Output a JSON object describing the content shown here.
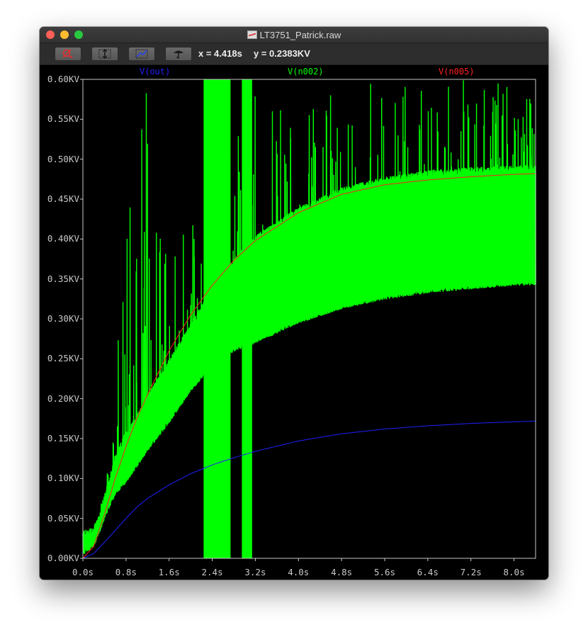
{
  "window": {
    "title": "LT3751_Patrick.raw"
  },
  "toolbar": {
    "buttons": [
      {
        "icon": "zoom-out-icon"
      },
      {
        "icon": "autorange-y-icon"
      },
      {
        "icon": "zoom-full-icon"
      },
      {
        "icon": "pan-icon"
      }
    ],
    "x_readout": "x = 4.418s",
    "y_readout": "y = 0.2383KV"
  },
  "colors": {
    "vout": "#2020ff",
    "vn002": "#00ff00",
    "vn005": "#ff2020",
    "axis": "#c8c8c8",
    "background": "#000000"
  },
  "chart_data": {
    "type": "line",
    "x_unit": "s",
    "y_unit": "KV",
    "xlim": [
      0.0,
      8.4
    ],
    "ylim": [
      0.0,
      0.6
    ],
    "x_ticks": [
      "0.0s",
      "0.8s",
      "1.6s",
      "2.4s",
      "3.2s",
      "4.0s",
      "4.8s",
      "5.6s",
      "6.4s",
      "7.2s",
      "8.0s"
    ],
    "y_ticks": [
      "0.00KV",
      "0.05KV",
      "0.10KV",
      "0.15KV",
      "0.20KV",
      "0.25KV",
      "0.30KV",
      "0.35KV",
      "0.40KV",
      "0.45KV",
      "0.50KV",
      "0.55KV",
      "0.60KV"
    ],
    "series": [
      {
        "name": "V(out)",
        "x": [
          0.0,
          0.2,
          0.4,
          0.6,
          0.8,
          1.0,
          1.2,
          1.6,
          2.0,
          2.4,
          2.8,
          3.2,
          4.0,
          4.8,
          5.6,
          6.4,
          7.2,
          8.0,
          8.4
        ],
        "y": [
          0.0,
          0.006,
          0.02,
          0.035,
          0.05,
          0.064,
          0.075,
          0.092,
          0.106,
          0.117,
          0.126,
          0.134,
          0.147,
          0.156,
          0.162,
          0.166,
          0.169,
          0.171,
          0.172
        ]
      },
      {
        "name": "V(n002)",
        "x": [
          0.0,
          0.2,
          0.3,
          0.4,
          0.6,
          0.8,
          1.0,
          1.2,
          1.6,
          2.0,
          2.4,
          2.8,
          3.2,
          4.0,
          4.8,
          5.6,
          6.4,
          7.2,
          8.0,
          8.4
        ],
        "y_upper": [
          0.025,
          0.03,
          0.045,
          0.07,
          0.12,
          0.15,
          0.17,
          0.195,
          0.24,
          0.285,
          0.33,
          0.365,
          0.395,
          0.43,
          0.455,
          0.468,
          0.476,
          0.48,
          0.482,
          0.483
        ],
        "y_lower": [
          0.01,
          0.02,
          0.035,
          0.055,
          0.085,
          0.1,
          0.12,
          0.14,
          0.175,
          0.215,
          0.245,
          0.265,
          0.275,
          0.3,
          0.318,
          0.33,
          0.338,
          0.343,
          0.347,
          0.348
        ],
        "y_peak": [
          0.03,
          0.04,
          0.06,
          0.09,
          0.17,
          0.6,
          0.6,
          0.6,
          0.37,
          0.43,
          0.6,
          0.52,
          0.6,
          0.55,
          0.6,
          0.6,
          0.6,
          0.6,
          0.6,
          0.6
        ]
      },
      {
        "name": "V(n005)",
        "x": [
          0.0,
          0.2,
          0.4,
          0.6,
          0.8,
          1.0,
          1.2,
          1.6,
          2.0,
          2.4,
          2.8,
          3.2,
          4.0,
          4.8,
          5.6,
          6.4,
          7.2,
          8.0,
          8.4
        ],
        "y": [
          0.0,
          0.015,
          0.055,
          0.1,
          0.14,
          0.175,
          0.205,
          0.26,
          0.305,
          0.342,
          0.373,
          0.398,
          0.433,
          0.456,
          0.468,
          0.474,
          0.478,
          0.481,
          0.482
        ]
      }
    ]
  }
}
